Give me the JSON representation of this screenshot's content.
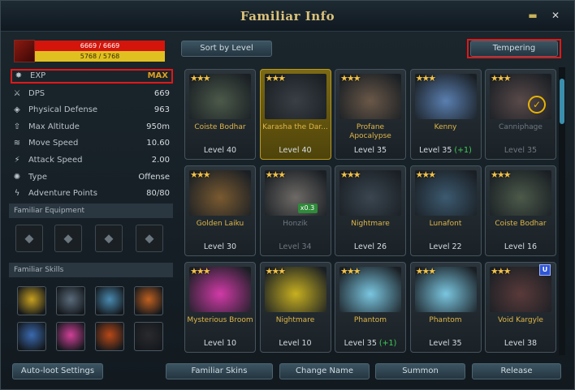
{
  "window": {
    "title": "Familiar Info",
    "minimize_icon": "minimize-icon",
    "close_icon": "close-icon"
  },
  "bars": {
    "hp": "6669 / 6669",
    "mp": "5768 / 5768"
  },
  "stats": [
    {
      "label": "EXP",
      "value": "MAX",
      "icon": "star-icon"
    },
    {
      "label": "DPS",
      "value": "669",
      "icon": "sword-icon"
    },
    {
      "label": "Physical Defense",
      "value": "963",
      "icon": "shield-icon"
    },
    {
      "label": "Max Altitude",
      "value": "950m",
      "icon": "altitude-icon"
    },
    {
      "label": "Move Speed",
      "value": "10.60",
      "icon": "wing-icon"
    },
    {
      "label": "Attack Speed",
      "value": "2.00",
      "icon": "attack-speed-icon"
    },
    {
      "label": "Type",
      "value": "Offense",
      "icon": "burst-icon"
    },
    {
      "label": "Adventure Points",
      "value": "80/80",
      "icon": "lightning-icon"
    }
  ],
  "sections": {
    "equipment": "Familiar Equipment",
    "skills": "Familiar Skills"
  },
  "buttons": {
    "sort": "Sort by Level",
    "tempering": "Tempering",
    "autoloot": "Auto-loot Settings",
    "skins": "Familiar Skins",
    "change_name": "Change Name",
    "summon": "Summon",
    "release": "Release"
  },
  "familiars": [
    {
      "name": "Coiste Bodhar",
      "level": "Level 40",
      "plus": "",
      "selected": false,
      "dim": false,
      "color": "#4c5a4a"
    },
    {
      "name": "Karasha the Dar...",
      "level": "Level 40",
      "plus": "",
      "selected": true,
      "dim": false,
      "color": "#3a3f45"
    },
    {
      "name": "Profane Apocalypse",
      "level": "Level 35",
      "plus": "",
      "selected": false,
      "dim": false,
      "color": "#6a5848"
    },
    {
      "name": "Kenny",
      "level": "Level 35",
      "plus": "(+1)",
      "selected": false,
      "dim": false,
      "color": "#5a7fb0"
    },
    {
      "name": "Canniphage",
      "level": "Level 35",
      "plus": "",
      "selected": false,
      "dim": true,
      "color": "#5a4a4a"
    },
    {
      "name": "Golden Laiku",
      "level": "Level 30",
      "plus": "",
      "selected": false,
      "dim": false,
      "color": "#7a5a30"
    },
    {
      "name": "Honzik",
      "level": "Level 34",
      "plus": "",
      "selected": false,
      "dim": true,
      "color": "#6e6a66"
    },
    {
      "name": "Nightmare",
      "level": "Level 26",
      "plus": "",
      "selected": false,
      "dim": false,
      "color": "#3a4650"
    },
    {
      "name": "Lunafont",
      "level": "Level 22",
      "plus": "",
      "selected": false,
      "dim": false,
      "color": "#3c5a70"
    },
    {
      "name": "Coiste Bodhar",
      "level": "Level 16",
      "plus": "",
      "selected": false,
      "dim": false,
      "color": "#4c5a4a"
    },
    {
      "name": "Mysterious Broom",
      "level": "Level 10",
      "plus": "",
      "selected": false,
      "dim": false,
      "color": "#d23aa8"
    },
    {
      "name": "Nightmare",
      "level": "Level 10",
      "plus": "",
      "selected": false,
      "dim": false,
      "color": "#c8b020"
    },
    {
      "name": "Phantom",
      "level": "Level 35",
      "plus": "(+1)",
      "selected": false,
      "dim": false,
      "color": "#7ac6e0"
    },
    {
      "name": "Phantom",
      "level": "Level 35",
      "plus": "",
      "selected": false,
      "dim": false,
      "color": "#7ac6e0"
    },
    {
      "name": "Void Kargyle",
      "level": "Level 38",
      "plus": "",
      "selected": false,
      "dim": false,
      "color": "#5a3a3a"
    }
  ],
  "badges": {
    "honzik_count": "x0.3",
    "void_tag": "U"
  },
  "skills": [
    {
      "icon": "golden-ring-skill-icon",
      "color": "#c8a020"
    },
    {
      "icon": "white-dragon-skill-icon",
      "color": "#5a6a7a"
    },
    {
      "icon": "ice-dragon-skill-icon",
      "color": "#4a8ab0"
    },
    {
      "icon": "fire-dragon-skill-icon",
      "color": "#c06020"
    },
    {
      "icon": "blue-dragon-skill-icon",
      "color": "#3a6ab0"
    },
    {
      "icon": "pink-beam-skill-icon",
      "color": "#d04098"
    },
    {
      "icon": "flame-dragon-skill-icon",
      "color": "#b84818"
    },
    {
      "icon": "dark-orb-skill-icon",
      "color": "#2a2a2e"
    }
  ]
}
